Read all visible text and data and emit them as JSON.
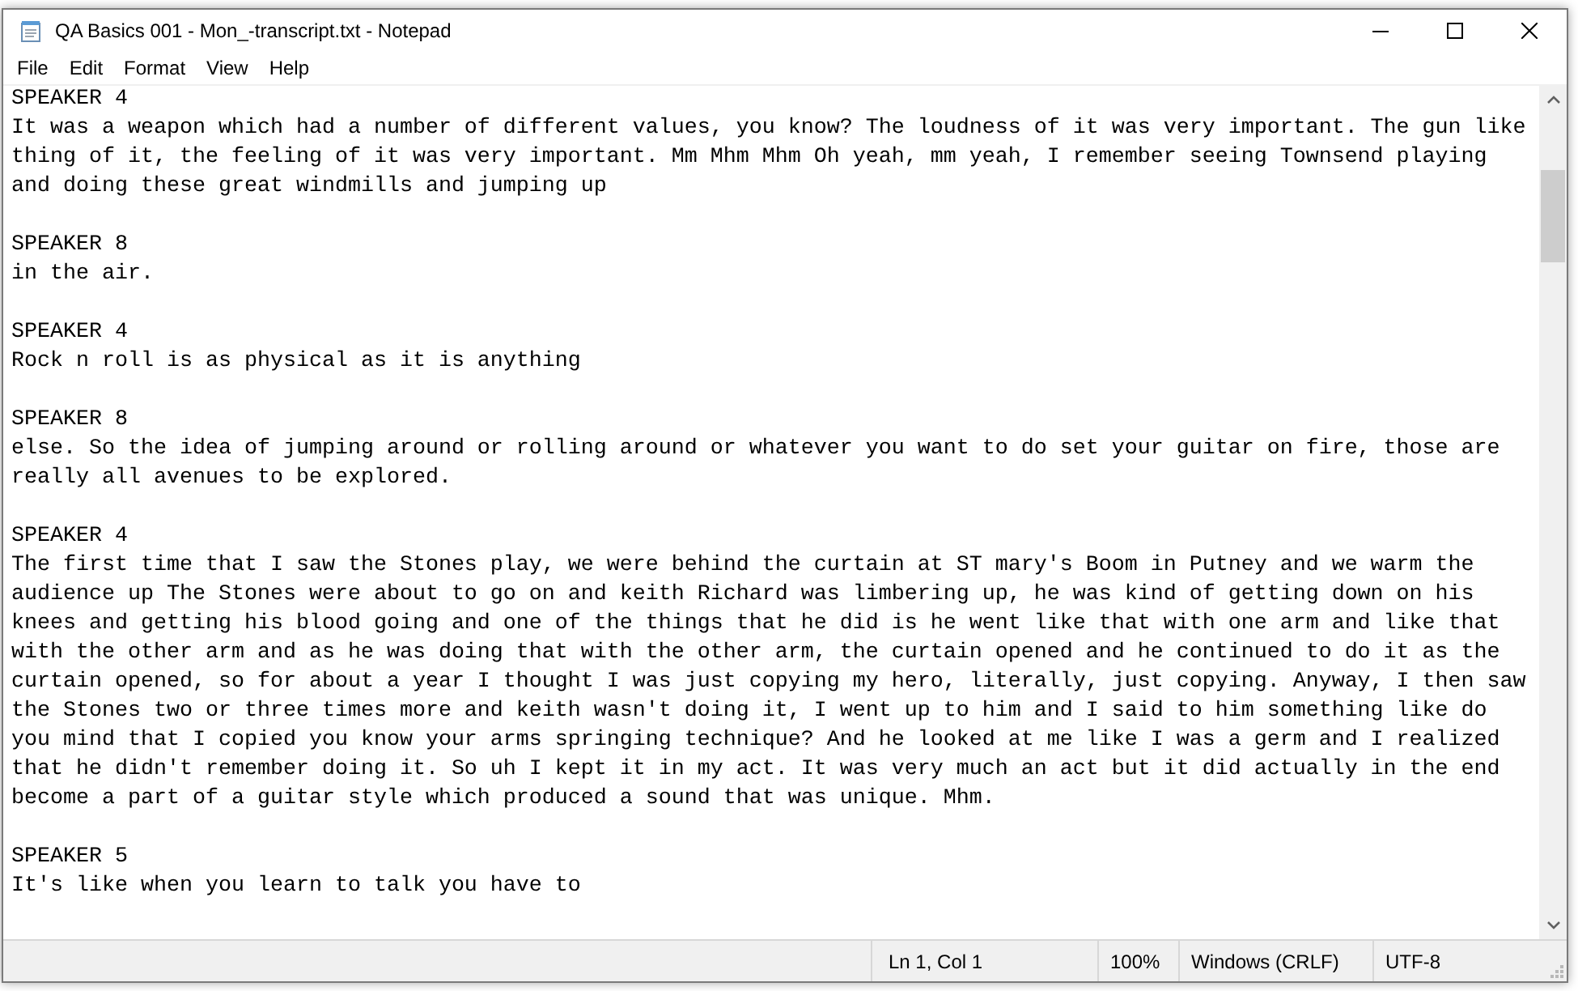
{
  "window": {
    "title": "QA Basics 001 - Mon_-transcript.txt - Notepad"
  },
  "menu": [
    "File",
    "Edit",
    "Format",
    "View",
    "Help"
  ],
  "document": {
    "entries": [
      {
        "speaker": "SPEAKER 4",
        "text": "It was a weapon which had a number of different values, you know? The loudness of it was very important. The gun like thing of it, the feeling of it was very important. Mm Mhm Mhm Oh yeah, mm yeah, I remember seeing Townsend playing and doing these great windmills and jumping up"
      },
      {
        "speaker": "SPEAKER 8",
        "text": "in the air."
      },
      {
        "speaker": "SPEAKER 4",
        "text": "Rock n roll is as physical as it is anything"
      },
      {
        "speaker": "SPEAKER 8",
        "text": "else. So the idea of jumping around or rolling around or whatever you want to do set your guitar on fire, those are really all avenues to be explored."
      },
      {
        "speaker": "SPEAKER 4",
        "text": "The first time that I saw the Stones play, we were behind the curtain at ST mary's Boom in Putney and we warm the audience up The Stones were about to go on and keith Richard was limbering up, he was kind of getting down on his knees and getting his blood going and one of the things that he did is he went like that with one arm and like that with the other arm and as he was doing that with the other arm, the curtain opened and he continued to do it as the curtain opened, so for about a year I thought I was just copying my hero, literally, just copying. Anyway, I then saw the Stones two or three times more and keith wasn't doing it, I went up to him and I said to him something like do you mind that I copied you know your arms springing technique? And he looked at me like I was a germ and I realized that he didn't remember doing it. So uh I kept it in my act. It was very much an act but it did actually in the end become a part of a guitar style which produced a sound that was unique. Mhm."
      },
      {
        "speaker": "SPEAKER 5",
        "text": "It's like when you learn to talk you have to"
      }
    ]
  },
  "status_bar": {
    "cursor_position": "Ln 1, Col 1",
    "zoom": "100%",
    "line_ending": "Windows (CRLF)",
    "encoding": "UTF-8"
  }
}
